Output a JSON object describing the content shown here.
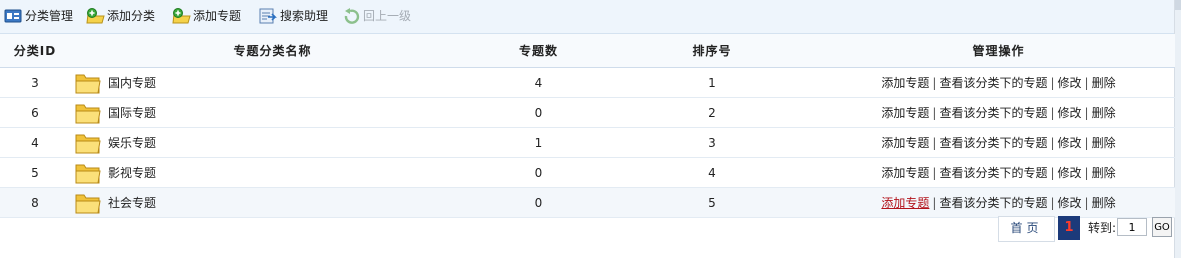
{
  "toolbar": {
    "items": [
      {
        "label": "分类管理",
        "icon": "category-manage-icon"
      },
      {
        "label": "添加分类",
        "icon": "add-category-icon"
      },
      {
        "label": "添加专题",
        "icon": "add-topic-icon"
      },
      {
        "label": "搜索助理",
        "icon": "search-assistant-icon"
      },
      {
        "label": "回上一级",
        "icon": "back-icon",
        "disabled": true
      }
    ]
  },
  "table": {
    "headers": {
      "id": "分类ID",
      "name": "专题分类名称",
      "count": "专题数",
      "sort": "排序号",
      "ops": "管理操作"
    },
    "ops_labels": {
      "add": "添加专题",
      "view": "查看该分类下的专题",
      "edit": "修改",
      "delete": "删除",
      "sep": "|"
    },
    "rows": [
      {
        "id": "3",
        "name": "国内专题",
        "count": "4",
        "sort": "1"
      },
      {
        "id": "6",
        "name": "国际专题",
        "count": "0",
        "sort": "2"
      },
      {
        "id": "4",
        "name": "娱乐专题",
        "count": "1",
        "sort": "3"
      },
      {
        "id": "5",
        "name": "影视专题",
        "count": "0",
        "sort": "4"
      },
      {
        "id": "8",
        "name": "社会专题",
        "count": "0",
        "sort": "5"
      }
    ]
  },
  "pager": {
    "first": "首页",
    "current": "1",
    "goto_label": "转到:",
    "input_value": "1",
    "go": "GO"
  },
  "colors": {
    "toolbar_bg": "#eef5fc",
    "link_hover": "#b3141c",
    "pager_current_bg": "#1c3a7a",
    "pager_current_text": "#ff3b2b"
  }
}
